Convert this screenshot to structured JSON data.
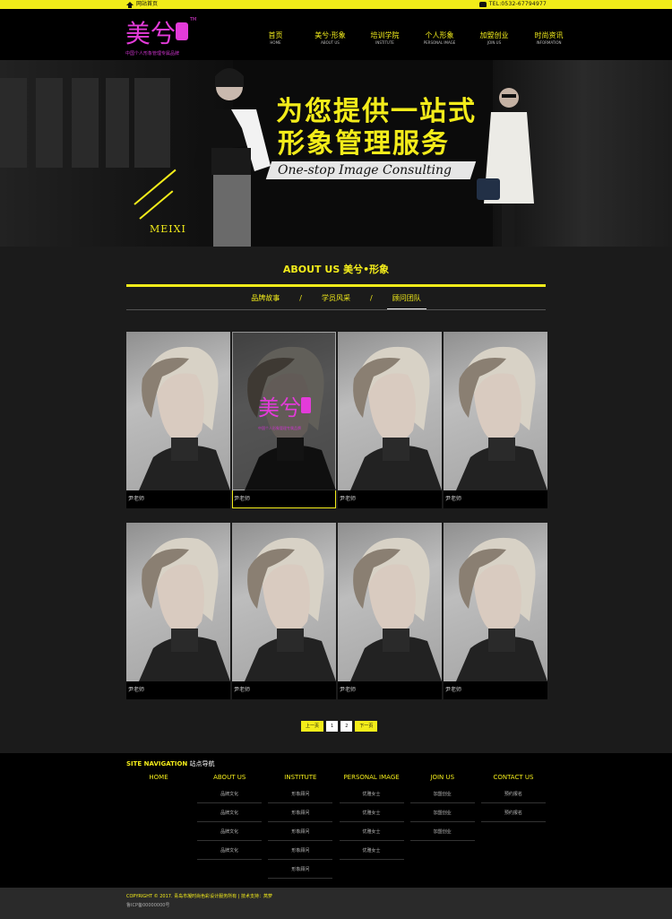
{
  "topbar": {
    "home_label": "网站首页",
    "tel_label": "TEL:0532-67794977",
    "colors": {
      "accent": "#f1ec19"
    }
  },
  "header": {
    "logo_text": "美兮形象",
    "logo_tagline": "中国个人形象管理专属品牌",
    "nav": [
      {
        "cn": "首页",
        "en": "HOME"
      },
      {
        "cn": "美兮·形象",
        "en": "ABOUT US"
      },
      {
        "cn": "培训学院",
        "en": "INSTITUTE"
      },
      {
        "cn": "个人形象",
        "en": "PERSONAL IMAGE"
      },
      {
        "cn": "加盟创业",
        "en": "JOIN US"
      },
      {
        "cn": "时尚资讯",
        "en": "INFORMATION"
      }
    ]
  },
  "banner": {
    "headline_1": "为您提供一站式",
    "headline_2": "形象管理服务",
    "subtitle": "One-stop Image Consulting",
    "brand_mark": "MEIXI"
  },
  "about": {
    "title": "ABOUT US 美兮•形象",
    "tabs": [
      "品牌故事",
      "学员风采",
      "顾问团队"
    ],
    "active_tab": "顾问团队"
  },
  "team": {
    "cards": [
      {
        "name": "尹老师"
      },
      {
        "name": "尹老师"
      },
      {
        "name": "尹老师"
      },
      {
        "name": "尹老师"
      },
      {
        "name": "尹老师"
      },
      {
        "name": "尹老师"
      },
      {
        "name": "尹老师"
      },
      {
        "name": "尹老师"
      }
    ],
    "overlay_logo": "美兮形象",
    "overlay_tagline": "中国个人形象管理专属品牌"
  },
  "pager": {
    "prev": "上一页",
    "pages": [
      "1",
      "2"
    ],
    "next": "下一页"
  },
  "footer": {
    "title_en": "SITE NAVIGATION",
    "title_cn": "站点导航",
    "columns": [
      {
        "head": "HOME",
        "links": []
      },
      {
        "head": "ABOUT US",
        "links": [
          "品牌文化",
          "品牌文化",
          "品牌文化",
          "品牌文化"
        ]
      },
      {
        "head": "INSTITUTE",
        "links": [
          "形象顾问",
          "形象顾问",
          "形象顾问",
          "形象顾问",
          "形象顾问"
        ]
      },
      {
        "head": "PERSONAL IMAGE",
        "links": [
          "优雅女士",
          "优雅女士",
          "优雅女士",
          "优雅女士"
        ]
      },
      {
        "head": "JOIN US",
        "links": [
          "加盟创业",
          "加盟创业",
          "加盟创业"
        ]
      },
      {
        "head": "CONTACT US",
        "links": [
          "预约报名",
          "预约报名"
        ]
      }
    ]
  },
  "bottom": {
    "copyright": "COPYRIGHT © 2017. 青岛市凝时尚色彩设计服务所有 | 技术支持：莴萝",
    "icp": "鲁ICP备00000000号"
  }
}
